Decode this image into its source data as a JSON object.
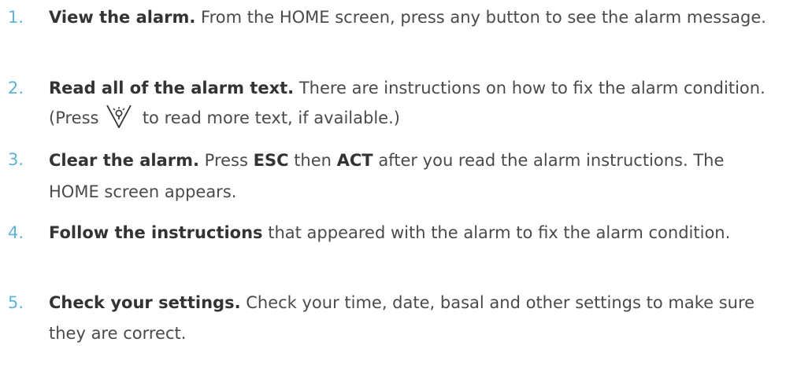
{
  "colors": {
    "number": "#5bb4dc",
    "text": "#4a4a4a",
    "bold": "#333333"
  },
  "steps": [
    {
      "number": "1.",
      "title": "View the alarm.",
      "text": " From the HOME screen, press any button to see the alarm message."
    },
    {
      "number": "2.",
      "title": "Read all of the alarm text.",
      "text_before_icon": " There are instructions on how to fix the alarm condition. (Press ",
      "icon": "backlight-button-icon",
      "text_after_icon": " to read more text, if available.)"
    },
    {
      "number": "3.",
      "title": "Clear the alarm.",
      "text_a": " Press ",
      "key1": "ESC",
      "text_b": " then ",
      "key2": "ACT",
      "text_c": " after you read the alarm instructions. The HOME screen appears."
    },
    {
      "number": "4.",
      "title": "Follow the instructions",
      "text": " that appeared with the alarm to fix the alarm condition."
    },
    {
      "number": "5.",
      "title": "Check your settings.",
      "text": " Check your time, date, basal and other settings to make sure they are correct."
    }
  ]
}
